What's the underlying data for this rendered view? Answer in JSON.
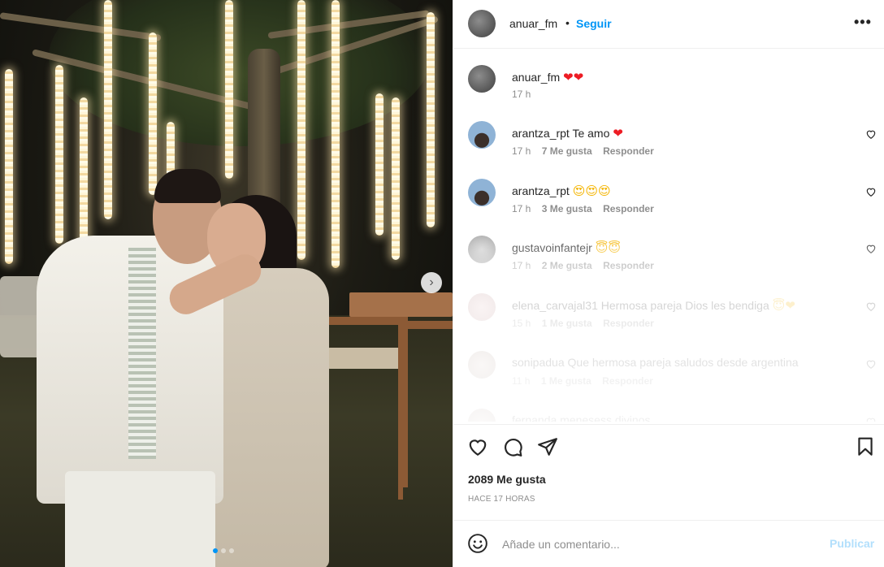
{
  "header": {
    "username": "anuar_fm",
    "separator": "•",
    "follow_label": "Seguir",
    "more_icon": "more-horizontal-icon"
  },
  "caption": {
    "username": "anuar_fm",
    "emoji": "❤❤",
    "time": "17 h"
  },
  "comments": [
    {
      "username": "arantza_rpt",
      "text": "Te amo",
      "emoji": "❤",
      "time": "17 h",
      "likes": "7 Me gusta",
      "reply": "Responder",
      "faded": false
    },
    {
      "username": "arantza_rpt",
      "text": "",
      "emoji": "😍😍😍",
      "time": "17 h",
      "likes": "3 Me gusta",
      "reply": "Responder",
      "faded": false
    },
    {
      "username": "gustavoinfantejr",
      "text": "",
      "emoji": "😇😇",
      "time": "17 h",
      "likes": "2 Me gusta",
      "reply": "Responder",
      "faded": true
    },
    {
      "username": "elena_carvajal31",
      "text": "Hermosa pareja Dios les bendiga",
      "emoji": "😇❤",
      "time": "15 h",
      "likes": "1 Me gusta",
      "reply": "Responder",
      "faded": true
    },
    {
      "username": "sonipadua",
      "text": "Que hermosa pareja saludos desde argentina",
      "emoji": "",
      "time": "11 h",
      "likes": "1 Me gusta",
      "reply": "Responder",
      "faded": true
    },
    {
      "username": "fernanda.menesess",
      "text": "divinos",
      "emoji": "",
      "time": "",
      "likes": "",
      "reply": "",
      "faded": true
    }
  ],
  "likes": "2089 Me gusta",
  "timestamp": "HACE 17 HORAS",
  "compose": {
    "placeholder": "Añade un comentario...",
    "publish_label": "Publicar"
  },
  "carousel": {
    "slides": 3,
    "active": 1
  },
  "colors": {
    "accent": "#0095f6",
    "publish_disabled": "#b2dffc",
    "meta": "#8e8e8e"
  }
}
